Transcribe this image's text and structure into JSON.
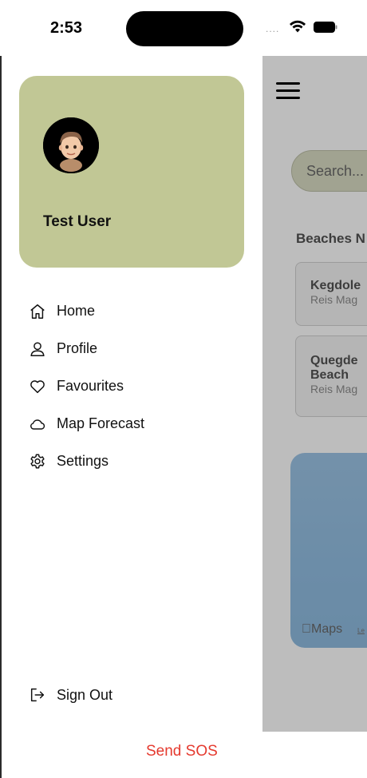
{
  "status_bar": {
    "time": "2:53",
    "signal_dots": "....",
    "wifi_icon": "wifi-icon",
    "battery_icon": "battery-icon"
  },
  "drawer": {
    "profile": {
      "name": "Test User",
      "card_color": "#c1c795",
      "avatar_icon": "memoji-avatar"
    },
    "nav_items": [
      {
        "label": "Home",
        "icon": "home-icon"
      },
      {
        "label": "Profile",
        "icon": "user-icon"
      },
      {
        "label": "Favourites",
        "icon": "heart-icon"
      },
      {
        "label": "Map Forecast",
        "icon": "cloud-icon"
      },
      {
        "label": "Settings",
        "icon": "gear-icon"
      }
    ],
    "sign_out": {
      "label": "Sign Out",
      "icon": "sign-out-icon"
    },
    "sos": {
      "label": "Send SOS",
      "color": "#e53a2f"
    }
  },
  "background_screen": {
    "menu_icon": "hamburger-menu-icon",
    "search_placeholder": "Search...",
    "section_heading": "Beaches N",
    "cards": [
      {
        "name": "Kegdole",
        "subtitle": "Reis Mag"
      },
      {
        "name": "Quegde",
        "name_line2": "Beach",
        "subtitle": "Reis Mag"
      }
    ],
    "map": {
      "brand": "Maps",
      "legal": "Le"
    }
  }
}
